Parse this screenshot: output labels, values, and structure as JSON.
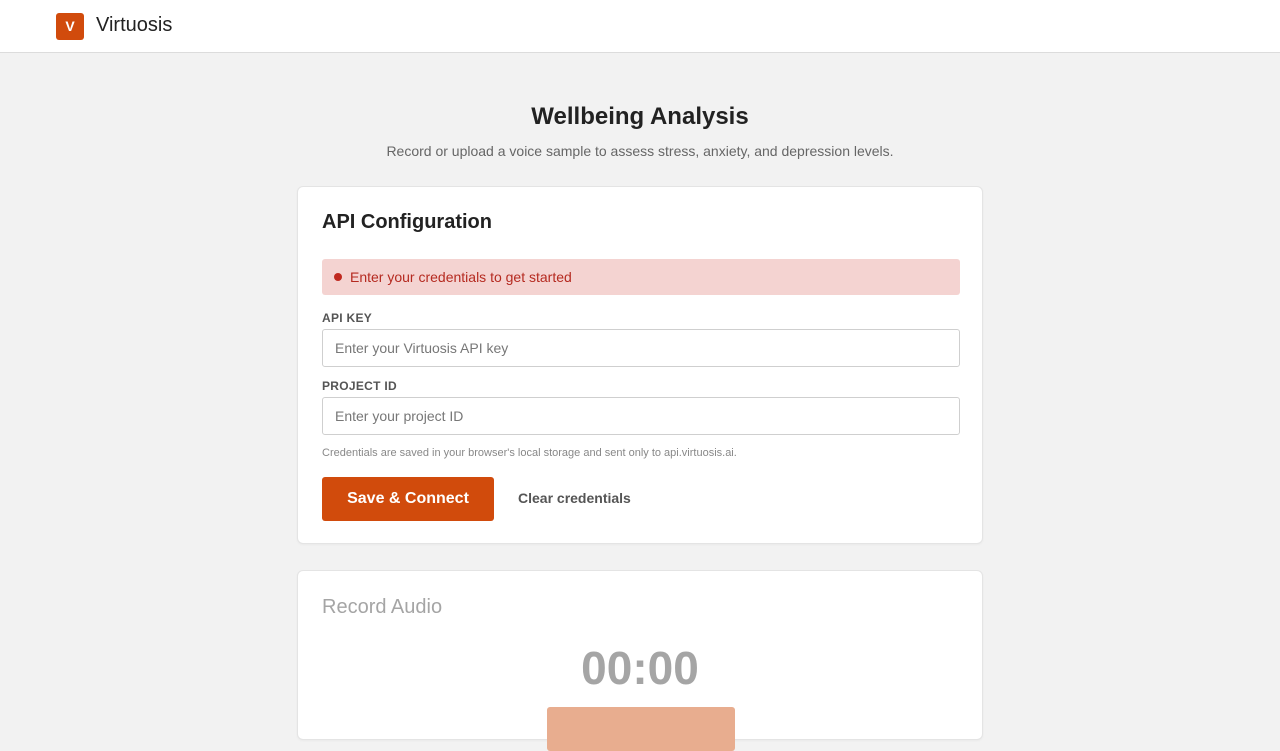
{
  "brand": {
    "logo_letter": "V",
    "name": "Virtuosis"
  },
  "header": {
    "title": "Wellbeing Analysis",
    "subtitle": "Record or upload a voice sample to assess stress, anxiety, and depression levels."
  },
  "config_card": {
    "title": "API Configuration",
    "alert_text": "Enter your credentials to get started",
    "api_key_label": "API KEY",
    "api_key_placeholder": "Enter your Virtuosis API key",
    "api_key_value": "",
    "project_id_label": "PROJECT ID",
    "project_id_placeholder": "Enter your project ID",
    "project_id_value": "",
    "hint": "Credentials are saved in your browser's local storage and sent only to api.virtuosis.ai.",
    "save_label": "Save & Connect",
    "clear_label": "Clear credentials"
  },
  "record_card": {
    "title": "Record Audio",
    "timer": "00:00"
  },
  "colors": {
    "accent": "#d14b0c",
    "alert_bg": "#f4d3d1",
    "alert_text": "#b52a20",
    "page_bg": "#f2f2f2"
  }
}
